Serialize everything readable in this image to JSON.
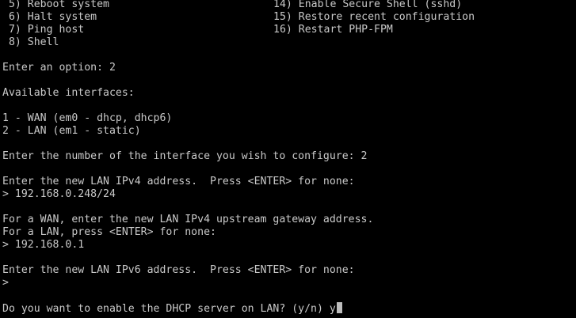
{
  "terminal": {
    "menu": [
      {
        "left": " 5) Reboot system",
        "right": "14) Enable Secure Shell (sshd)"
      },
      {
        "left": " 6) Halt system",
        "right": "15) Restore recent configuration"
      },
      {
        "left": " 7) Ping host",
        "right": "16) Restart PHP-FPM"
      },
      {
        "left": " 8) Shell",
        "right": ""
      }
    ],
    "option_prompt": "Enter an option: 2",
    "available_interfaces": "Available interfaces:",
    "interface_1": "1 - WAN (em0 - dhcp, dhcp6)",
    "interface_2": "2 - LAN (em1 - static)",
    "interface_number_prompt": "Enter the number of the interface you wish to configure: 2",
    "ipv4_prompt": "Enter the new LAN IPv4 address.  Press <ENTER> for none:",
    "ipv4_value": "> 192.168.0.248/24",
    "gateway_prompt_1": "For a WAN, enter the new LAN IPv4 upstream gateway address.",
    "gateway_prompt_2": "For a LAN, press <ENTER> for none:",
    "gateway_value": "> 192.168.0.1",
    "ipv6_prompt": "Enter the new LAN IPv6 address.  Press <ENTER> for none:",
    "ipv6_value": ">",
    "dhcp_prompt": "Do you want to enable the DHCP server on LAN? (y/n) ",
    "dhcp_input": "y"
  }
}
